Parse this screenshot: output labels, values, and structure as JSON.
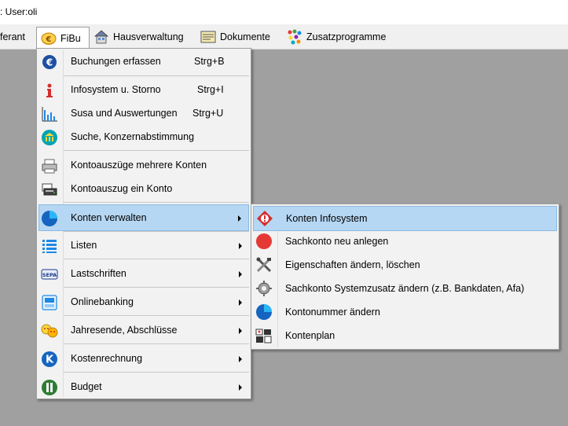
{
  "title": {
    "text": ": User:oli"
  },
  "menubar": {
    "items": [
      {
        "label": "ferant"
      },
      {
        "label": "FiBu"
      },
      {
        "label": "Hausverwaltung"
      },
      {
        "label": "Dokumente"
      },
      {
        "label": "Zusatzprogramme"
      }
    ]
  },
  "fibu_menu": {
    "items": [
      {
        "label": "Buchungen erfassen",
        "shortcut": "Strg+B"
      },
      {
        "label": "Infosystem u. Storno",
        "shortcut": "Strg+I"
      },
      {
        "label": "Susa und Auswertungen",
        "shortcut": "Strg+U"
      },
      {
        "label": "Suche, Konzernabstimmung"
      },
      {
        "label": "Kontoauszüge mehrere Konten"
      },
      {
        "label": "Kontoauszug ein Konto"
      },
      {
        "label": "Konten verwalten"
      },
      {
        "label": "Listen"
      },
      {
        "label": "Lastschriften"
      },
      {
        "label": "Onlinebanking"
      },
      {
        "label": "Jahresende, Abschlüsse"
      },
      {
        "label": "Kostenrechnung"
      },
      {
        "label": "Budget"
      }
    ]
  },
  "konten_submenu": {
    "items": [
      {
        "label": "Konten Infosystem"
      },
      {
        "label": "Sachkonto neu anlegen"
      },
      {
        "label": "Eigenschaften ändern, löschen"
      },
      {
        "label": "Sachkonto Systemzusatz ändern (z.B. Bankdaten, Afa)"
      },
      {
        "label": "Kontonummer ändern"
      },
      {
        "label": "Kontenplan"
      }
    ]
  },
  "colors": {
    "desktop": "#a0a0a0",
    "menu_bg": "#f2f2f2",
    "highlight": "#b6d7f3",
    "highlight_border": "#8ab9e3"
  },
  "icons": {
    "buchungen": "euro-icon",
    "infosystem": "info-icon",
    "susa": "bar-chart-icon",
    "suche": "search-bank-icon",
    "kontoauszuege": "printer-icon",
    "kontoauszug": "printer-stack-icon",
    "konten": "pie-chart-icon",
    "listen": "list-icon",
    "lastschriften": "sepa-icon",
    "onlinebanking": "online-banking-icon",
    "jahresende": "year-end-icon",
    "kostenrechnung": "k-badge-icon",
    "budget": "b-badge-icon"
  }
}
